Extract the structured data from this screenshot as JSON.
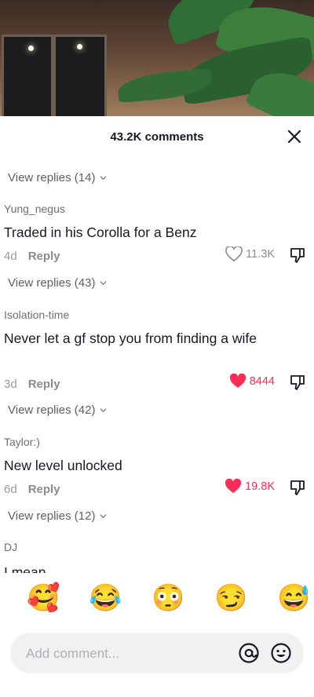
{
  "header": {
    "title": "43.2K comments",
    "close_icon": "close-icon"
  },
  "top_view_replies": "View replies (14)",
  "comments": [
    {
      "username": "Yung_negus",
      "text": "Traded in his Corolla for a Benz",
      "age": "4d",
      "reply": "Reply",
      "likes": "11.3K",
      "liked": false,
      "view_replies": "View replies (43)"
    },
    {
      "username": "Isolation-time",
      "text": "Never let a gf stop you from finding a wife",
      "age": "3d",
      "reply": "Reply",
      "likes": "8444",
      "liked": true,
      "view_replies": "View replies (42)"
    },
    {
      "username": "Taylor:)",
      "text": "New level unlocked",
      "age": "6d",
      "reply": "Reply",
      "likes": "19.8K",
      "liked": true,
      "view_replies": "View replies (12)"
    },
    {
      "username": "DJ",
      "text": "I mean"
    }
  ],
  "emojis": [
    "🥰",
    "😂",
    "😳",
    "😏",
    "😅"
  ],
  "input": {
    "placeholder": "Add comment...",
    "value": ""
  },
  "colors": {
    "like_active": "#fe2c55",
    "text": "#161823",
    "muted": "#8a8a90"
  }
}
